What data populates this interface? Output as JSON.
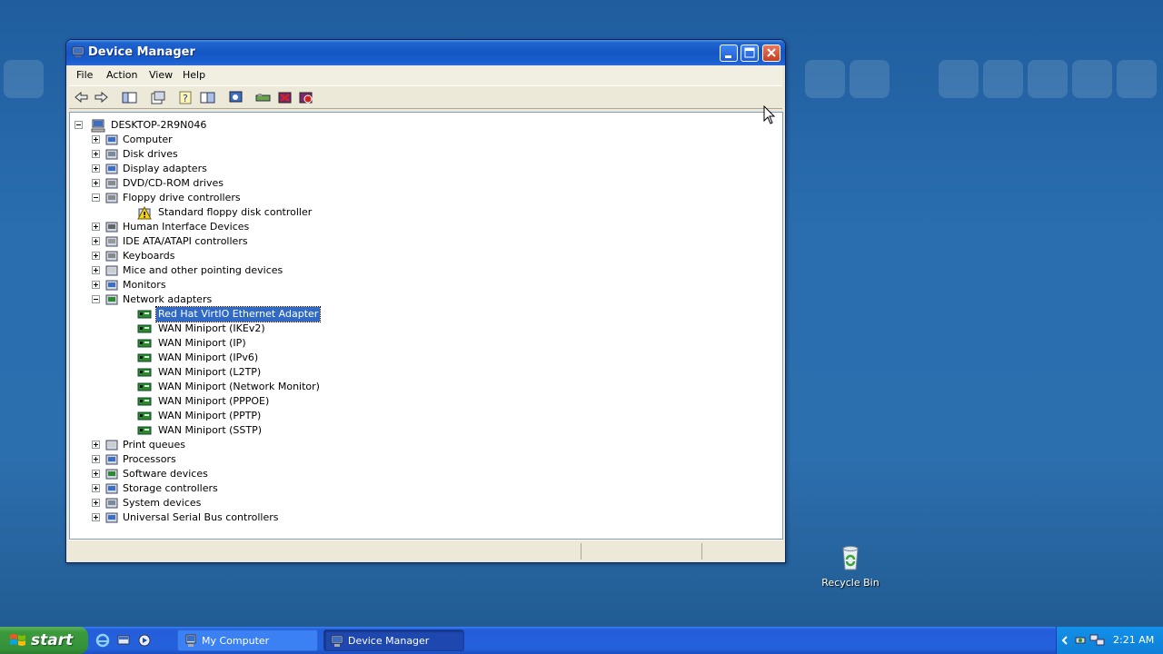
{
  "window": {
    "title": "Device Manager",
    "menu": [
      "File",
      "Action",
      "View",
      "Help"
    ]
  },
  "toolbar_icons": [
    "back-icon",
    "forward-icon",
    "show-hide-console-tree-icon",
    "properties-icon",
    "help-icon",
    "details-pane-icon",
    "scan-hardware-icon",
    "update-driver-icon",
    "uninstall-icon",
    "disable-icon"
  ],
  "tree": {
    "root": "DESKTOP-2R9N046",
    "categories": [
      {
        "label": "Computer",
        "expanded": false
      },
      {
        "label": "Disk drives",
        "expanded": false
      },
      {
        "label": "Display adapters",
        "expanded": false
      },
      {
        "label": "DVD/CD-ROM drives",
        "expanded": false
      },
      {
        "label": "Floppy drive controllers",
        "expanded": true
      },
      {
        "label": "Standard floppy disk controller",
        "child": true,
        "warning": true
      },
      {
        "label": "Human Interface Devices",
        "expanded": false
      },
      {
        "label": "IDE ATA/ATAPI controllers",
        "expanded": false
      },
      {
        "label": "Keyboards",
        "expanded": false
      },
      {
        "label": "Mice and other pointing devices",
        "expanded": false
      },
      {
        "label": "Monitors",
        "expanded": false
      },
      {
        "label": "Network adapters",
        "expanded": true
      },
      {
        "label": "Red Hat VirtIO Ethernet Adapter",
        "child": true,
        "selected": true
      },
      {
        "label": "WAN Miniport (IKEv2)",
        "child": true
      },
      {
        "label": "WAN Miniport (IP)",
        "child": true
      },
      {
        "label": "WAN Miniport (IPv6)",
        "child": true
      },
      {
        "label": "WAN Miniport (L2TP)",
        "child": true
      },
      {
        "label": "WAN Miniport (Network Monitor)",
        "child": true
      },
      {
        "label": "WAN Miniport (PPPOE)",
        "child": true
      },
      {
        "label": "WAN Miniport (PPTP)",
        "child": true
      },
      {
        "label": "WAN Miniport (SSTP)",
        "child": true
      },
      {
        "label": "Print queues",
        "expanded": false
      },
      {
        "label": "Processors",
        "expanded": false
      },
      {
        "label": "Software devices",
        "expanded": false
      },
      {
        "label": "Storage controllers",
        "expanded": false
      },
      {
        "label": "System devices",
        "expanded": false
      },
      {
        "label": "Universal Serial Bus controllers",
        "expanded": false
      }
    ]
  },
  "desktop": {
    "recycle_bin": "Recycle Bin"
  },
  "taskbar": {
    "start": "start",
    "tasks": [
      {
        "label": "My Computer",
        "active": false
      },
      {
        "label": "Device Manager",
        "active": true
      }
    ],
    "clock": "2:21 AM"
  },
  "colors": {
    "selection": "#316ac5",
    "titlebar": "#1556c4",
    "start_green": "#3c9a3c",
    "desktop": "#2a6eb0"
  }
}
